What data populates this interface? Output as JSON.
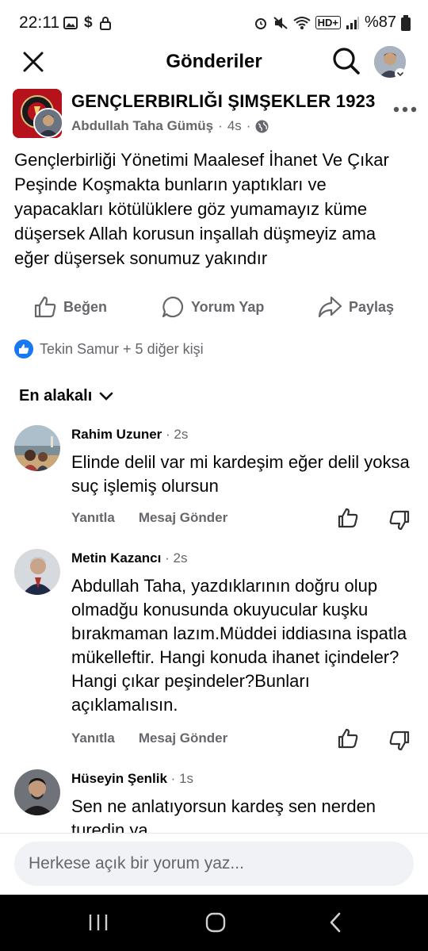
{
  "status_bar": {
    "time": "22:11",
    "battery": "%87"
  },
  "header": {
    "title": "Gönderiler"
  },
  "post": {
    "group_name": "GENÇLERBIRLIĞI ŞIMŞEKLER 1923",
    "author": "Abdullah Taha Gümüş",
    "time": "4s",
    "text": "Gençlerbirliği Yönetimi Maalesef İhanet Ve Çıkar Peşinde Koşmakta bunların yaptıkları ve yapacakları kötülüklere göz yumamayız küme düşersek Allah korusun inşallah düşmeyiz ama eğer düşersek sonumuz yakındır"
  },
  "actions": {
    "like": "Beğen",
    "comment": "Yorum Yap",
    "share": "Paylaş"
  },
  "reactions": {
    "text": "Tekin Samur + 5 diğer kişi"
  },
  "sort": {
    "label": "En alakalı"
  },
  "comments": [
    {
      "name": "Rahim Uzuner",
      "time": "2s",
      "text": "Elinde delil var mi kardeşim eğer delil yoksa suç işlemiş olursun",
      "reply": "Yanıtla",
      "message": "Mesaj Gönder"
    },
    {
      "name": "Metin Kazancı",
      "time": "2s",
      "text": "Abdullah Taha, yazdıklarının doğru olup olmadğu konusunda okuyucular kuşku bırakmaman lazım.Müddei iddiasına ispatla mükelleftir. Hangi konuda ihanet içindeler? Hangi çıkar peşindeler?Bunları açıklamalısın.",
      "reply": "Yanıtla",
      "message": "Mesaj Gönder"
    },
    {
      "name": "Hüseyin Şenlik",
      "time": "1s",
      "text": "Sen ne anlatıyorsun kardeş sen nerden turedin ya"
    }
  ],
  "comment_input": {
    "placeholder": "Herkese açık bir yorum yaz..."
  },
  "colors": {
    "accent": "#1877f2",
    "secondary_text": "#65676b",
    "group_red": "#b5121b"
  }
}
